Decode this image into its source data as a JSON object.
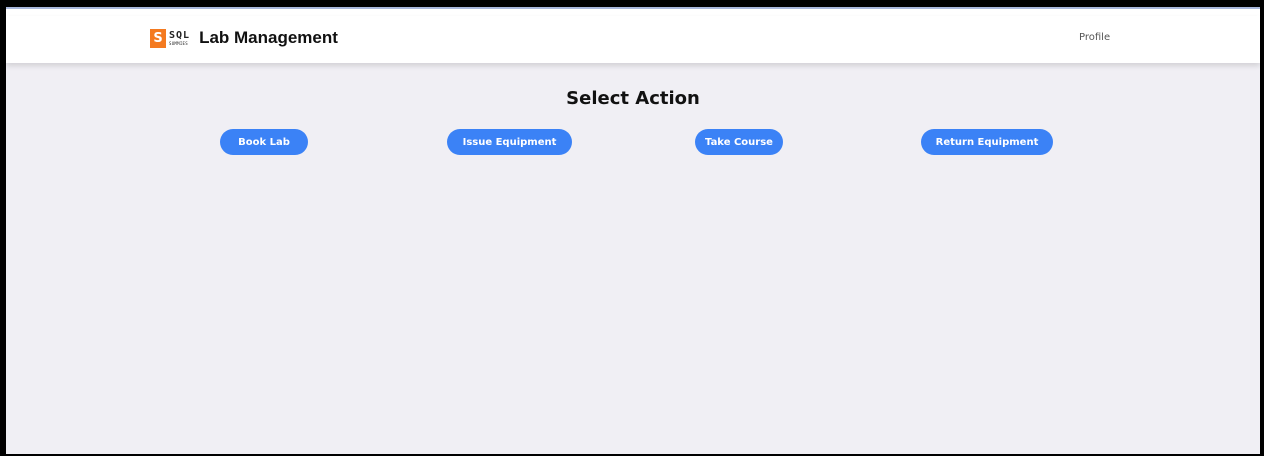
{
  "app": {
    "logo_letter": "S",
    "logo_text": "SQL",
    "logo_subtext": "SUMMIES",
    "title": "Lab Management",
    "brand_color": "#f47a20"
  },
  "nav": {
    "profile_label": "Profile"
  },
  "main": {
    "heading": "Select Action",
    "accent_color": "#3b82f6",
    "actions": [
      {
        "label": "Book Lab"
      },
      {
        "label": "Issue Equipment"
      },
      {
        "label": "Take Course"
      },
      {
        "label": "Return Equipment"
      }
    ]
  }
}
